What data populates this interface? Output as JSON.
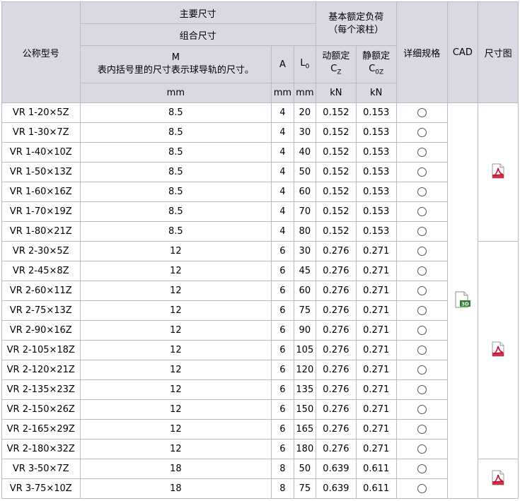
{
  "header": {
    "model": "公称型号",
    "main_dims": "主要尺寸",
    "combo_dims": "组合尺寸",
    "rated_load": "基本额定负荷",
    "rated_load_sub": "（每个滚柱）",
    "detail": "详细规格",
    "cad": "CAD",
    "drawing": "尺寸图",
    "m_label": "M",
    "m_note": "表内括号里的尺寸表示球导轨的尺寸。",
    "a_label": "A",
    "l_label": "L",
    "l_sub": "0",
    "dyn_label": "动额定",
    "dyn_sym": "C",
    "dyn_sub": "Z",
    "static_label": "静额定",
    "static_sym": "C",
    "static_sub": "0Z",
    "unit_m": "mm",
    "unit_a": "mm",
    "unit_l": "mm",
    "unit_dyn": "kN",
    "unit_static": "kN"
  },
  "rows": [
    {
      "model": "VR 1-20×5Z",
      "m": "8.5",
      "a": "4",
      "l": "20",
      "cz": "0.152",
      "c0z": "0.153"
    },
    {
      "model": "VR 1-30×7Z",
      "m": "8.5",
      "a": "4",
      "l": "30",
      "cz": "0.152",
      "c0z": "0.153"
    },
    {
      "model": "VR 1-40×10Z",
      "m": "8.5",
      "a": "4",
      "l": "40",
      "cz": "0.152",
      "c0z": "0.153"
    },
    {
      "model": "VR 1-50×13Z",
      "m": "8.5",
      "a": "4",
      "l": "50",
      "cz": "0.152",
      "c0z": "0.153"
    },
    {
      "model": "VR 1-60×16Z",
      "m": "8.5",
      "a": "4",
      "l": "60",
      "cz": "0.152",
      "c0z": "0.153"
    },
    {
      "model": "VR 1-70×19Z",
      "m": "8.5",
      "a": "4",
      "l": "70",
      "cz": "0.152",
      "c0z": "0.153"
    },
    {
      "model": "VR 1-80×21Z",
      "m": "8.5",
      "a": "4",
      "l": "80",
      "cz": "0.152",
      "c0z": "0.153"
    },
    {
      "model": "VR 2-30×5Z",
      "m": "12",
      "a": "6",
      "l": "30",
      "cz": "0.276",
      "c0z": "0.271"
    },
    {
      "model": "VR 2-45×8Z",
      "m": "12",
      "a": "6",
      "l": "45",
      "cz": "0.276",
      "c0z": "0.271"
    },
    {
      "model": "VR 2-60×11Z",
      "m": "12",
      "a": "6",
      "l": "60",
      "cz": "0.276",
      "c0z": "0.271"
    },
    {
      "model": "VR 2-75×13Z",
      "m": "12",
      "a": "6",
      "l": "75",
      "cz": "0.276",
      "c0z": "0.271"
    },
    {
      "model": "VR 2-90×16Z",
      "m": "12",
      "a": "6",
      "l": "90",
      "cz": "0.276",
      "c0z": "0.271"
    },
    {
      "model": "VR 2-105×18Z",
      "m": "12",
      "a": "6",
      "l": "105",
      "cz": "0.276",
      "c0z": "0.271"
    },
    {
      "model": "VR 2-120×21Z",
      "m": "12",
      "a": "6",
      "l": "120",
      "cz": "0.276",
      "c0z": "0.271"
    },
    {
      "model": "VR 2-135×23Z",
      "m": "12",
      "a": "6",
      "l": "135",
      "cz": "0.276",
      "c0z": "0.271"
    },
    {
      "model": "VR 2-150×26Z",
      "m": "12",
      "a": "6",
      "l": "150",
      "cz": "0.276",
      "c0z": "0.271"
    },
    {
      "model": "VR 2-165×29Z",
      "m": "12",
      "a": "6",
      "l": "165",
      "cz": "0.276",
      "c0z": "0.271"
    },
    {
      "model": "VR 2-180×32Z",
      "m": "12",
      "a": "6",
      "l": "180",
      "cz": "0.276",
      "c0z": "0.271"
    },
    {
      "model": "VR 3-50×7Z",
      "m": "18",
      "a": "8",
      "l": "50",
      "cz": "0.639",
      "c0z": "0.611"
    },
    {
      "model": "VR 3-75×10Z",
      "m": "18",
      "a": "8",
      "l": "75",
      "cz": "0.639",
      "c0z": "0.611"
    }
  ],
  "cad_icon": "cad-3d-file-icon",
  "pdf_icon": "pdf-file-icon",
  "detail_icon": "radio-circle-icon",
  "colors": {
    "header_bg": "#d9d9e4",
    "border": "#b9b9c8",
    "pdf_red": "#c8102e",
    "cad_green": "#2f7d2f"
  }
}
